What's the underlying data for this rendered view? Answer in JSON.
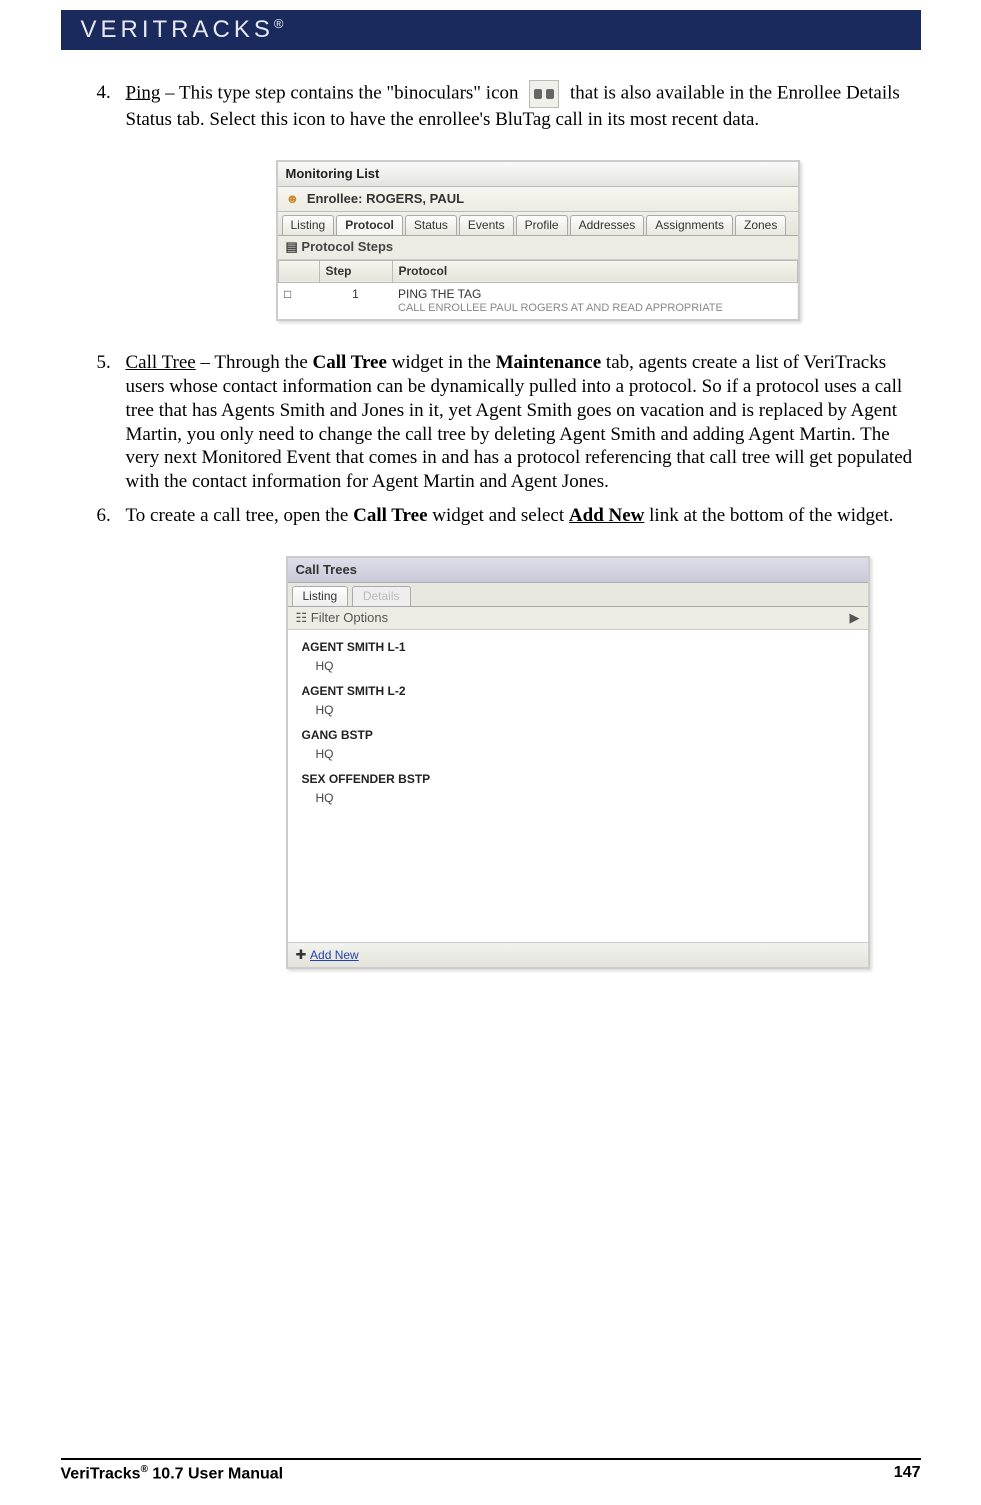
{
  "header": {
    "logo": "VERITRACKS",
    "reg": "®"
  },
  "items": {
    "4": {
      "term": "Ping",
      "text1": " – This type step contains the \"binoculars\" icon ",
      "text2": " that is also available in the Enrollee Details Status tab.  Select this icon to have the enrollee's BluTag call in its most recent data."
    },
    "5": {
      "term": "Call Tree",
      "t1": " – Through the ",
      "b1": "Call Tree",
      "t2": " widget in the ",
      "b2": "Maintenance",
      "t3": " tab, agents create a list of VeriTracks users whose contact information can be dynamically pulled into a protocol.  So if a protocol uses a call tree that has Agents Smith and Jones in it, yet Agent Smith goes on vacation and is replaced by Agent Martin, you only need to change the call tree by deleting Agent Smith and adding Agent Martin.  The very next Monitored Event that comes in and has a protocol referencing that call tree will get populated with the contact information for Agent Martin and Agent Jones."
    },
    "6": {
      "t1": "To create a call tree, open the ",
      "b1": "Call Tree",
      "t2": " widget and select ",
      "bu": "Add New",
      "t3": " link at the bottom of the widget."
    }
  },
  "ml": {
    "title": "Monitoring List",
    "enrollee_label": "Enrollee: ",
    "enrollee_name": "ROGERS, PAUL",
    "tabs": [
      "Listing",
      "Protocol",
      "Status",
      "Events",
      "Profile",
      "Addresses",
      "Assignments",
      "Zones"
    ],
    "section": "Protocol Steps",
    "headers": {
      "blank": "",
      "step": "Step",
      "protocol": "Protocol"
    },
    "row": {
      "step": "1",
      "title": "PING THE TAG",
      "sub": "CALL ENROLLEE PAUL ROGERS AT AND READ APPROPRIATE"
    }
  },
  "ct": {
    "title": "Call Trees",
    "tabs": [
      "Listing",
      "Details"
    ],
    "filter": "Filter Options",
    "items": [
      {
        "name": "AGENT SMITH L-1",
        "loc": "HQ"
      },
      {
        "name": "AGENT SMITH L-2",
        "loc": "HQ"
      },
      {
        "name": "GANG BSTP",
        "loc": "HQ"
      },
      {
        "name": "SEX OFFENDER BSTP",
        "loc": "HQ"
      }
    ],
    "addnew": "Add New"
  },
  "footer": {
    "left1": "VeriTracks",
    "reg": "®",
    "left2": " 10.7 User Manual",
    "page": "147"
  }
}
